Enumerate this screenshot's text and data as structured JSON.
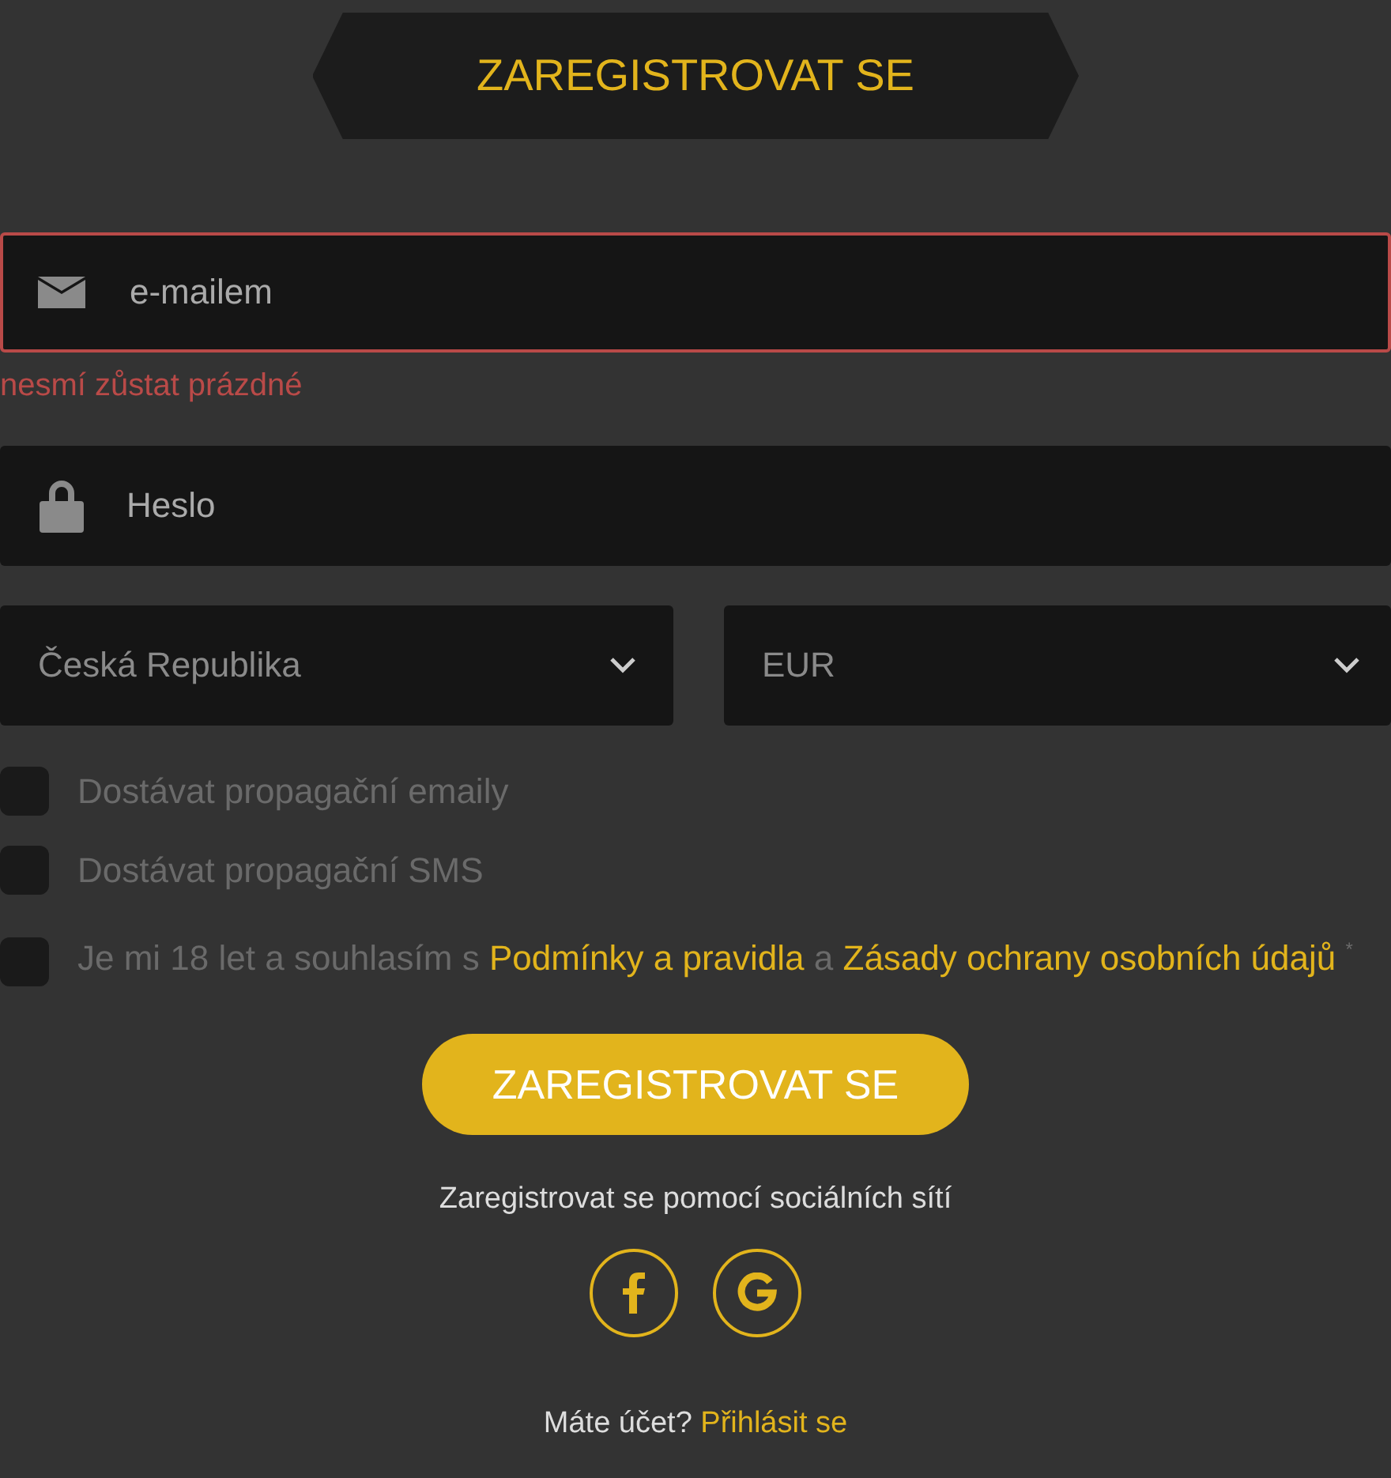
{
  "header": {
    "title": "ZAREGISTROVAT SE"
  },
  "email": {
    "placeholder": "e-mailem",
    "invalid": true,
    "error": "nesmí zůstat prázdné"
  },
  "password": {
    "placeholder": "Heslo"
  },
  "selects": [
    {
      "value": "Česká Republika"
    },
    {
      "value": "EUR"
    }
  ],
  "checkboxes": [
    {
      "checked": false,
      "parts": [
        {
          "kind": "text",
          "text": "Dostávat propagační emaily"
        }
      ]
    },
    {
      "checked": false,
      "parts": [
        {
          "kind": "text",
          "text": "Dostávat propagační SMS"
        }
      ]
    },
    {
      "checked": false,
      "parts": [
        {
          "kind": "text",
          "text": "Je mi 18 let a souhlasím s "
        },
        {
          "kind": "link",
          "text": "Podmínky a pravidla"
        },
        {
          "kind": "text",
          "text": " a "
        },
        {
          "kind": "link",
          "text": "Zásady ochrany osobních údajů"
        },
        {
          "kind": "text",
          "text": " $^{*}$"
        }
      ]
    }
  ],
  "submit": {
    "label": "ZAREGISTROVAT SE"
  },
  "social": {
    "label": "Zaregistrovat se pomocí sociálních sítí",
    "buttons": [
      {
        "kind": "facebook"
      },
      {
        "kind": "google"
      }
    ]
  },
  "footer": {
    "question": "Máte účet?",
    "link": "Přihlásit se"
  }
}
